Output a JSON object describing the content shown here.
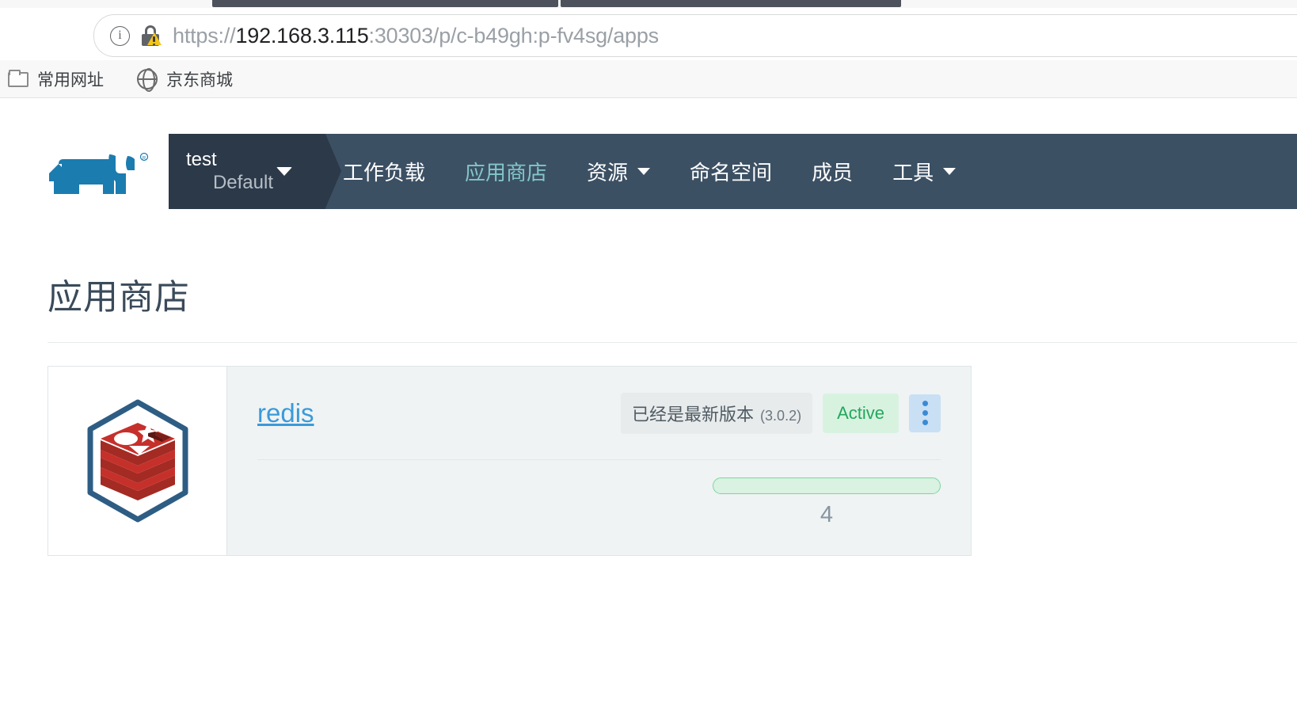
{
  "browser": {
    "url_prefix": "https://",
    "url_host": "192.168.3.115",
    "url_rest": ":30303/p/c-b49gh:p-fv4sg/apps",
    "info_icon": "info-circle-icon",
    "security_icon": "lock-warning-icon",
    "bookmarks": [
      {
        "label": "常用网址",
        "icon": "folder-icon"
      },
      {
        "label": "京东商城",
        "icon": "globe-icon"
      }
    ]
  },
  "nav": {
    "logo": "rancher-logo",
    "cluster": {
      "name": "test",
      "project": "Default",
      "chevron": "chevron-down-icon"
    },
    "items": [
      {
        "label": "工作负载",
        "active": false,
        "chevron": false
      },
      {
        "label": "应用商店",
        "active": true,
        "chevron": false
      },
      {
        "label": "资源",
        "active": false,
        "chevron": true
      },
      {
        "label": "命名空间",
        "active": false,
        "chevron": false
      },
      {
        "label": "成员",
        "active": false,
        "chevron": false
      },
      {
        "label": "工具",
        "active": false,
        "chevron": true
      }
    ]
  },
  "page": {
    "title": "应用商店"
  },
  "app_card": {
    "logo": "redis-logo",
    "name": "redis",
    "version_badge": "已经是最新版本",
    "version_number": "(3.0.2)",
    "status": "Active",
    "menu_icon": "kebab-menu-icon",
    "pod_count": "4",
    "progress_color": "#7ed6a0",
    "progress_fill": "#d9f2e1"
  },
  "colors": {
    "nav_bg": "#3c5064",
    "cluster_bg": "#2c3949",
    "nav_active": "#82c6c9",
    "link": "#3a9ad9",
    "status_green": "#23a85c",
    "card_bg": "#eff3f4"
  }
}
